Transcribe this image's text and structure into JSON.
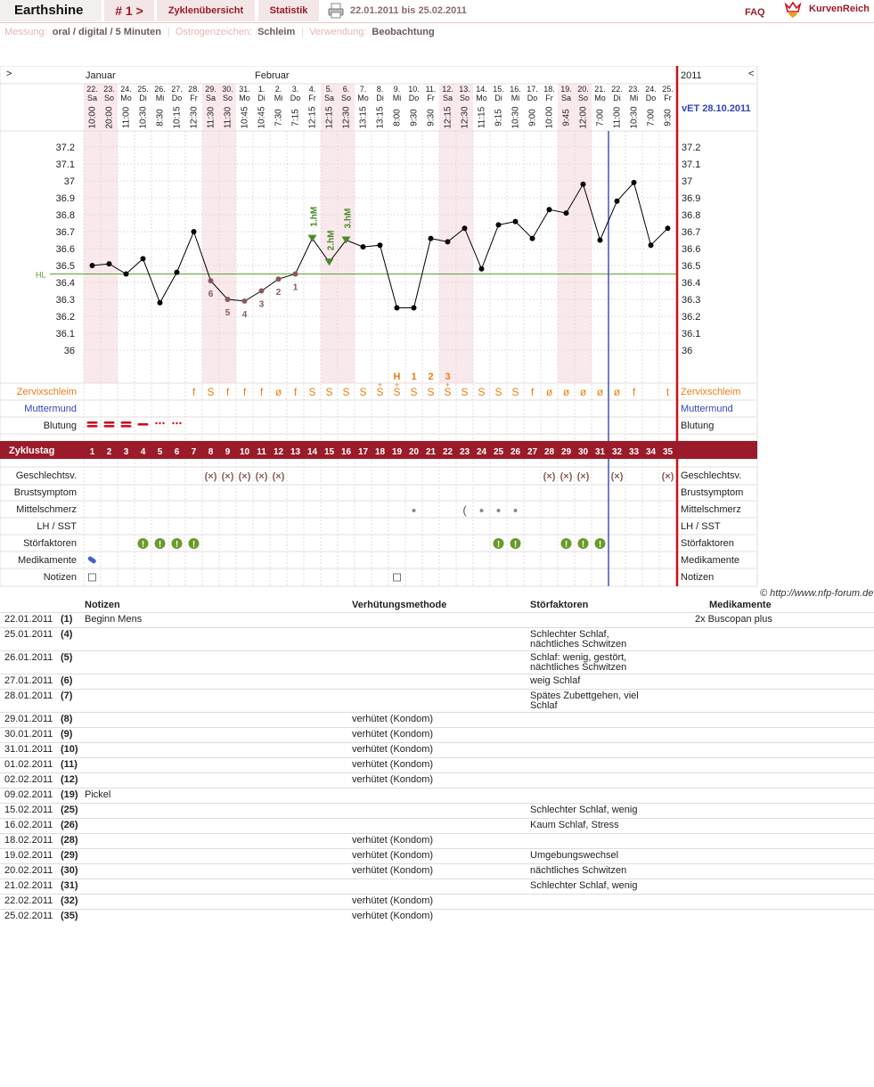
{
  "topbar": {
    "app_name": "Earthshine",
    "cycle_label": "# 1 >",
    "overview_label": "Zyklenübersicht",
    "stats_label": "Statistik",
    "date_range": "22.01.2011 bis 25.02.2011",
    "faq_label": "FAQ",
    "brand": "KurvenReich",
    "print_icon": "printer-icon",
    "logo_icon": "heart-crown-icon"
  },
  "info": {
    "measure_label": "Messung:",
    "measure_value": "oral / digital / 5 Minuten",
    "estrogen_label": "Östrogenzeichen:",
    "estrogen_value": "Schleim",
    "use_label": "Verwendung:",
    "use_value": "Beobachtung"
  },
  "chart_header": {
    "nav_left": ">",
    "nav_right": "<",
    "year": "2011",
    "due_date": "vET 28.10.2011",
    "months": [
      {
        "label": "Januar",
        "start_day": 0
      },
      {
        "label": "Februar",
        "start_day": 10
      }
    ]
  },
  "colors": {
    "accent": "#9b1b2a",
    "chart_line": "#000000",
    "coverline": "#5aa52a",
    "peak_marker": "#4a8a2a",
    "mucus": "#e87f14",
    "cervix": "#3344bb",
    "bleeding": "#cc1122",
    "stress_dot": "#6a9a2a",
    "post_ovulation_line": "#3344bb",
    "weekend_bg": "#f9e8ec"
  },
  "chart_data": {
    "type": "line",
    "title": "",
    "ylabel": "",
    "xlabel": "",
    "ylim": [
      35.9,
      37.25
    ],
    "yticks": [
      "37.2",
      "37.1",
      "37",
      "36.9",
      "36.8",
      "36.7",
      "36.6",
      "36.5",
      "36.4",
      "36.3",
      "36.2",
      "36.1",
      "36"
    ],
    "coverline": 36.45,
    "coverline_label": "HL",
    "ovulation_after_cycle_day": 31,
    "days": [
      {
        "d": "22.",
        "w": "Sa",
        "t": "10:00",
        "temp": 36.5,
        "cd": "1",
        "bleed": "heavy",
        "med": true,
        "note": true,
        "we": true
      },
      {
        "d": "23.",
        "w": "So",
        "t": "20:00",
        "temp": 36.51,
        "cd": "2",
        "bleed": "heavy",
        "we": true
      },
      {
        "d": "24.",
        "w": "Mo",
        "t": "11:00",
        "temp": 36.45,
        "cd": "3",
        "bleed": "heavy"
      },
      {
        "d": "25.",
        "w": "Di",
        "t": "10:30",
        "temp": 36.54,
        "cd": "4",
        "bleed": "medium",
        "stress": true
      },
      {
        "d": "26.",
        "w": "Mi",
        "t": "8:30",
        "temp": 36.28,
        "cd": "5",
        "bleed": "light",
        "stress": true
      },
      {
        "d": "27.",
        "w": "Do",
        "t": "10:15",
        "temp": 36.46,
        "cd": "6",
        "bleed": "light",
        "stress": true
      },
      {
        "d": "28.",
        "w": "Fr",
        "t": "12:30",
        "temp": 36.7,
        "cd": "7",
        "mucus": "f",
        "stress": true
      },
      {
        "d": "29.",
        "w": "Sa",
        "t": "11:30",
        "temp": 36.41,
        "cd": "8",
        "mucus": "S",
        "lower": "6",
        "sex": true,
        "we": true
      },
      {
        "d": "30.",
        "w": "So",
        "t": "11:30",
        "temp": 36.3,
        "cd": "9",
        "mucus": "f",
        "lower": "5",
        "sex": true,
        "we": true
      },
      {
        "d": "31.",
        "w": "Mo",
        "t": "10:45",
        "temp": 36.29,
        "cd": "10",
        "mucus": "f",
        "lower": "4",
        "sex": true
      },
      {
        "d": "1.",
        "w": "Di",
        "t": "10:45",
        "temp": 36.35,
        "cd": "11",
        "mucus": "f",
        "lower": "3",
        "sex": true
      },
      {
        "d": "2.",
        "w": "Mi",
        "t": "7:30",
        "temp": 36.42,
        "cd": "12",
        "mucus": "ø",
        "lower": "2",
        "sex": true
      },
      {
        "d": "3.",
        "w": "Do",
        "t": "7:15",
        "temp": 36.45,
        "cd": "13",
        "mucus": "f",
        "lower": "1"
      },
      {
        "d": "4.",
        "w": "Fr",
        "t": "12:15",
        "temp": 36.66,
        "cd": "14",
        "mucus": "S",
        "hm": "1.hM"
      },
      {
        "d": "5.",
        "w": "Sa",
        "t": "12:15",
        "temp": 36.52,
        "cd": "15",
        "mucus": "S",
        "hm": "2.hM",
        "we": true
      },
      {
        "d": "6.",
        "w": "So",
        "t": "12:30",
        "temp": 36.65,
        "cd": "16",
        "mucus": "S",
        "hm": "3.hM",
        "we": true
      },
      {
        "d": "7.",
        "w": "Mo",
        "t": "13:15",
        "temp": 36.61,
        "cd": "17",
        "mucus": "S"
      },
      {
        "d": "8.",
        "w": "Di",
        "t": "13:15",
        "temp": 36.62,
        "cd": "18",
        "mucus": "S+"
      },
      {
        "d": "9.",
        "w": "Mi",
        "t": "8:00",
        "temp": 36.25,
        "cd": "19",
        "mucus": "S+",
        "peak": "H",
        "note": true
      },
      {
        "d": "10.",
        "w": "Do",
        "t": "9:30",
        "temp": 36.25,
        "cd": "20",
        "mucus": "S",
        "peak": "1",
        "pain": "dot"
      },
      {
        "d": "11.",
        "w": "Fr",
        "t": "9:30",
        "temp": 36.66,
        "cd": "21",
        "mucus": "S",
        "peak": "2"
      },
      {
        "d": "12.",
        "w": "Sa",
        "t": "12:15",
        "temp": 36.64,
        "cd": "22",
        "mucus": "S+",
        "peak": "3",
        "we": true
      },
      {
        "d": "13.",
        "w": "So",
        "t": "12:30",
        "temp": 36.72,
        "cd": "23",
        "mucus": "S",
        "pain": "moon",
        "we": true
      },
      {
        "d": "14.",
        "w": "Mo",
        "t": "11:15",
        "temp": 36.48,
        "cd": "24",
        "mucus": "S",
        "pain": "dot"
      },
      {
        "d": "15.",
        "w": "Di",
        "t": "9:15",
        "temp": 36.74,
        "cd": "25",
        "mucus": "S",
        "pain": "dot",
        "stress": true
      },
      {
        "d": "16.",
        "w": "Mi",
        "t": "10:30",
        "temp": 36.76,
        "cd": "26",
        "mucus": "S",
        "pain": "dot",
        "stress": true
      },
      {
        "d": "17.",
        "w": "Do",
        "t": "9:00",
        "temp": 36.66,
        "cd": "27",
        "mucus": "f"
      },
      {
        "d": "18.",
        "w": "Fr",
        "t": "10:00",
        "temp": 36.83,
        "cd": "28",
        "mucus": "ø",
        "sex": true
      },
      {
        "d": "19.",
        "w": "Sa",
        "t": "9:45",
        "temp": 36.81,
        "cd": "29",
        "mucus": "ø",
        "sex": true,
        "stress": true,
        "we": true
      },
      {
        "d": "20.",
        "w": "So",
        "t": "12:00",
        "temp": 36.98,
        "cd": "30",
        "mucus": "ø",
        "sex": true,
        "stress": true,
        "we": true
      },
      {
        "d": "21.",
        "w": "Mo",
        "t": "7:00",
        "temp": 36.65,
        "cd": "31",
        "mucus": "ø",
        "stress": true
      },
      {
        "d": "22.",
        "w": "Di",
        "t": "11:00",
        "temp": 36.88,
        "cd": "32",
        "mucus": "ø",
        "sex": true
      },
      {
        "d": "23.",
        "w": "Mi",
        "t": "10:30",
        "temp": 36.99,
        "cd": "33",
        "mucus": "f"
      },
      {
        "d": "24.",
        "w": "Do",
        "t": "7:00",
        "temp": 36.62,
        "cd": "34"
      },
      {
        "d": "25.",
        "w": "Fr",
        "t": "9:30",
        "temp": 36.72,
        "cd": "35",
        "mucus": "t",
        "sex": true
      }
    ],
    "row_labels": {
      "mucus": "Zervixschleim",
      "cervix": "Muttermund",
      "bleeding": "Blutung",
      "cycle_day": "Zyklustag",
      "sex": "Geschlechtsv.",
      "breast": "Brustsymptom",
      "pain": "Mittelschmerz",
      "lh": "LH / SST",
      "stress": "Störfaktoren",
      "meds": "Medikamente",
      "notes": "Notizen"
    }
  },
  "copyright": "© http://www.nfp-forum.de",
  "notes_table": {
    "headers": {
      "notes": "Notizen",
      "method": "Verhütungsmethode",
      "disturb": "Störfaktoren",
      "meds": "Medikamente"
    },
    "rows": [
      {
        "date": "22.01.2011",
        "cd": "(1)",
        "note": "Beginn Mens",
        "method": "",
        "disturb": "",
        "meds": "2x Buscopan plus"
      },
      {
        "date": "25.01.2011",
        "cd": "(4)",
        "note": "",
        "method": "",
        "disturb": "Schlechter Schlaf, nächtliches Schwitzen",
        "meds": ""
      },
      {
        "date": "26.01.2011",
        "cd": "(5)",
        "note": "",
        "method": "",
        "disturb": "Schlaf: wenig, gestört, nächtliches Schwitzen",
        "meds": ""
      },
      {
        "date": "27.01.2011",
        "cd": "(6)",
        "note": "",
        "method": "",
        "disturb": "weig Schlaf",
        "meds": ""
      },
      {
        "date": "28.01.2011",
        "cd": "(7)",
        "note": "",
        "method": "",
        "disturb": "Spätes Zubettgehen, viel Schlaf",
        "meds": ""
      },
      {
        "date": "29.01.2011",
        "cd": "(8)",
        "note": "",
        "method": "verhütet (Kondom)",
        "disturb": "",
        "meds": ""
      },
      {
        "date": "30.01.2011",
        "cd": "(9)",
        "note": "",
        "method": "verhütet (Kondom)",
        "disturb": "",
        "meds": ""
      },
      {
        "date": "31.01.2011",
        "cd": "(10)",
        "note": "",
        "method": "verhütet (Kondom)",
        "disturb": "",
        "meds": ""
      },
      {
        "date": "01.02.2011",
        "cd": "(11)",
        "note": "",
        "method": "verhütet (Kondom)",
        "disturb": "",
        "meds": ""
      },
      {
        "date": "02.02.2011",
        "cd": "(12)",
        "note": "",
        "method": "verhütet (Kondom)",
        "disturb": "",
        "meds": ""
      },
      {
        "date": "09.02.2011",
        "cd": "(19)",
        "note": "Pickel",
        "method": "",
        "disturb": "",
        "meds": ""
      },
      {
        "date": "15.02.2011",
        "cd": "(25)",
        "note": "",
        "method": "",
        "disturb": "Schlechter Schlaf, wenig",
        "meds": ""
      },
      {
        "date": "16.02.2011",
        "cd": "(26)",
        "note": "",
        "method": "",
        "disturb": "Kaum Schlaf, Stress",
        "meds": ""
      },
      {
        "date": "18.02.2011",
        "cd": "(28)",
        "note": "",
        "method": "verhütet (Kondom)",
        "disturb": "",
        "meds": ""
      },
      {
        "date": "19.02.2011",
        "cd": "(29)",
        "note": "",
        "method": "verhütet (Kondom)",
        "disturb": "Umgebungswechsel",
        "meds": ""
      },
      {
        "date": "20.02.2011",
        "cd": "(30)",
        "note": "",
        "method": "verhütet (Kondom)",
        "disturb": "nächtliches Schwitzen",
        "meds": ""
      },
      {
        "date": "21.02.2011",
        "cd": "(31)",
        "note": "",
        "method": "",
        "disturb": "Schlechter Schlaf, wenig",
        "meds": ""
      },
      {
        "date": "22.02.2011",
        "cd": "(32)",
        "note": "",
        "method": "verhütet (Kondom)",
        "disturb": "",
        "meds": ""
      },
      {
        "date": "25.02.2011",
        "cd": "(35)",
        "note": "",
        "method": "verhütet (Kondom)",
        "disturb": "",
        "meds": ""
      }
    ]
  }
}
